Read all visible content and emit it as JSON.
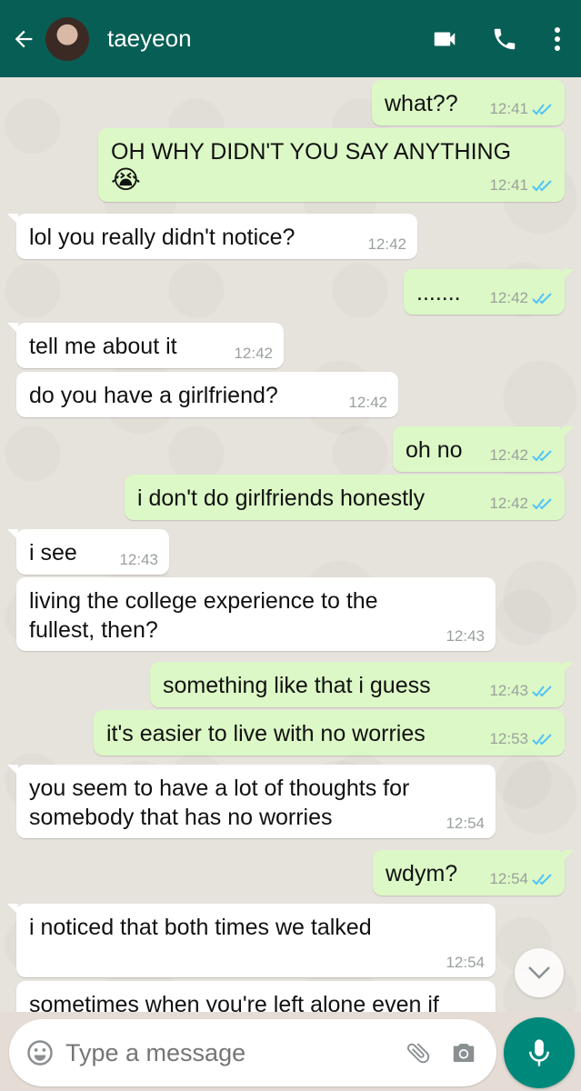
{
  "header": {
    "contact_name": "taeyeon",
    "icons": [
      "back-arrow-icon",
      "video-call-icon",
      "phone-icon",
      "more-options-icon"
    ]
  },
  "messages": [
    {
      "dir": "out",
      "text": "what??",
      "time": "12:41",
      "status": "read"
    },
    {
      "dir": "out",
      "text": "OH WHY DIDN'T YOU SAY ANYTHING",
      "emoji": "😭",
      "time": "12:41",
      "status": "read"
    },
    {
      "dir": "in",
      "text": "lol you really didn't notice?",
      "time": "12:42"
    },
    {
      "dir": "out",
      "text": ".......",
      "time": "12:42",
      "status": "read"
    },
    {
      "dir": "in",
      "text": "tell me about it",
      "time": "12:42"
    },
    {
      "dir": "in",
      "text": "do you have a girlfriend?",
      "time": "12:42"
    },
    {
      "dir": "out",
      "text": "oh no",
      "time": "12:42",
      "status": "read"
    },
    {
      "dir": "out",
      "text": "i don't do girlfriends honestly",
      "time": "12:42",
      "status": "read"
    },
    {
      "dir": "in",
      "text": "i see",
      "time": "12:43"
    },
    {
      "dir": "in",
      "text": "living the college experience to the fullest, then?",
      "time": "12:43"
    },
    {
      "dir": "out",
      "text": "something like that i guess",
      "time": "12:43",
      "status": "read"
    },
    {
      "dir": "out",
      "text": "it's easier to live with no worries",
      "time": "12:53",
      "status": "read"
    },
    {
      "dir": "in",
      "text": "you seem to have a lot of thoughts for somebody that has no worries",
      "time": "12:54"
    },
    {
      "dir": "out",
      "text": "wdym?",
      "time": "12:54",
      "status": "read"
    },
    {
      "dir": "in",
      "text": "i noticed that both times we talked",
      "time": "12:54"
    },
    {
      "dir": "in",
      "text": "sometimes when you're left alone even if",
      "time": ""
    }
  ],
  "composer": {
    "placeholder": "Type a message",
    "icons": [
      "emoji-icon",
      "attach-icon",
      "camera-icon",
      "mic-icon"
    ]
  },
  "colors": {
    "header": "#075e54",
    "outgoing_bubble": "#dcf8c6",
    "incoming_bubble": "#ffffff",
    "read_tick": "#4fc3f7",
    "mic_button": "#00897b"
  }
}
